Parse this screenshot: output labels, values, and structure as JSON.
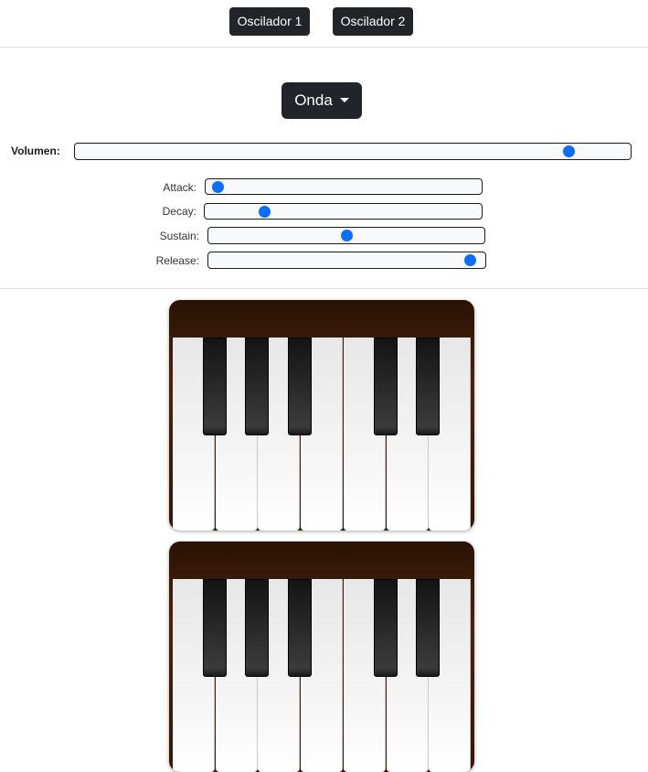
{
  "tabs": [
    {
      "label": "Oscilador 1"
    },
    {
      "label": "Oscilador 2"
    }
  ],
  "dropdown": {
    "label": "Onda"
  },
  "volume": {
    "label": "Volumen:",
    "value_fraction": 0.9
  },
  "adsr": [
    {
      "label": "Attack:",
      "value_fraction": 0.02
    },
    {
      "label": "Decay:",
      "value_fraction": 0.2
    },
    {
      "label": "Sustain:",
      "value_fraction": 0.5
    },
    {
      "label": "Release:",
      "value_fraction": 0.97
    }
  ],
  "colors": {
    "button_bg": "#212529",
    "slider_thumb": "#0d6efd",
    "piano_case": "#3b1a07"
  },
  "pianos": [
    {
      "white_keys": 7,
      "black_keys": 5
    },
    {
      "white_keys": 7,
      "black_keys": 5
    }
  ]
}
